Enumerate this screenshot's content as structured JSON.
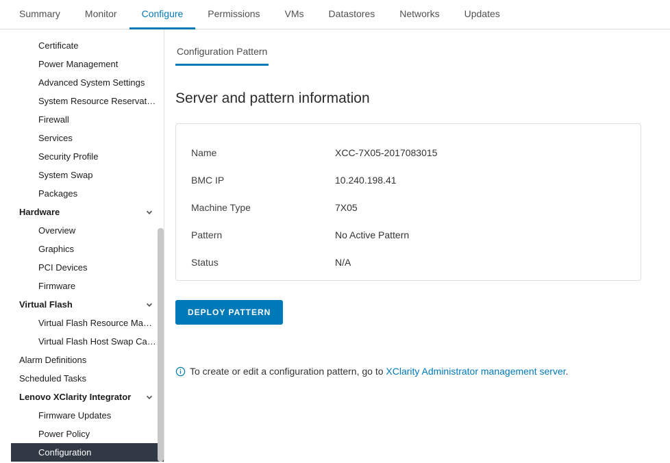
{
  "topTabs": {
    "summary": "Summary",
    "monitor": "Monitor",
    "configure": "Configure",
    "permissions": "Permissions",
    "vms": "VMs",
    "datastores": "Datastores",
    "networks": "Networks",
    "updates": "Updates"
  },
  "sidebar": {
    "system_items": {
      "certificate": "Certificate",
      "power_management": "Power Management",
      "advanced_system_settings": "Advanced System Settings",
      "system_resource_reservation": "System Resource Reservati…",
      "firewall": "Firewall",
      "services": "Services",
      "security_profile": "Security Profile",
      "system_swap": "System Swap",
      "packages": "Packages"
    },
    "hardware_heading": "Hardware",
    "hardware_items": {
      "overview": "Overview",
      "graphics": "Graphics",
      "pci_devices": "PCI Devices",
      "firmware": "Firmware"
    },
    "vflash_heading": "Virtual Flash",
    "vflash_items": {
      "resource_mgmt": "Virtual Flash Resource Man…",
      "host_swap_cache": "Virtual Flash Host Swap Ca…"
    },
    "alarm_definitions": "Alarm Definitions",
    "scheduled_tasks": "Scheduled Tasks",
    "lxci_heading": "Lenovo XClarity Integrator",
    "lxci_items": {
      "firmware_updates": "Firmware Updates",
      "power_policy": "Power Policy",
      "configuration": "Configuration"
    }
  },
  "contentTab": "Configuration Pattern",
  "pageTitle": "Server and pattern information",
  "info": {
    "labels": {
      "name": "Name",
      "bmc_ip": "BMC IP",
      "machine_type": "Machine Type",
      "pattern": "Pattern",
      "status": "Status"
    },
    "values": {
      "name": "XCC-7X05-2017083015",
      "bmc_ip": "10.240.198.41",
      "machine_type": "7X05",
      "pattern": "No Active Pattern",
      "status": "N/A"
    }
  },
  "deploy_button": "DEPLOY PATTERN",
  "hint": {
    "prefix": "To create or edit a configuration pattern, go to ",
    "link": "XClarity Administrator management server",
    "suffix": "."
  }
}
